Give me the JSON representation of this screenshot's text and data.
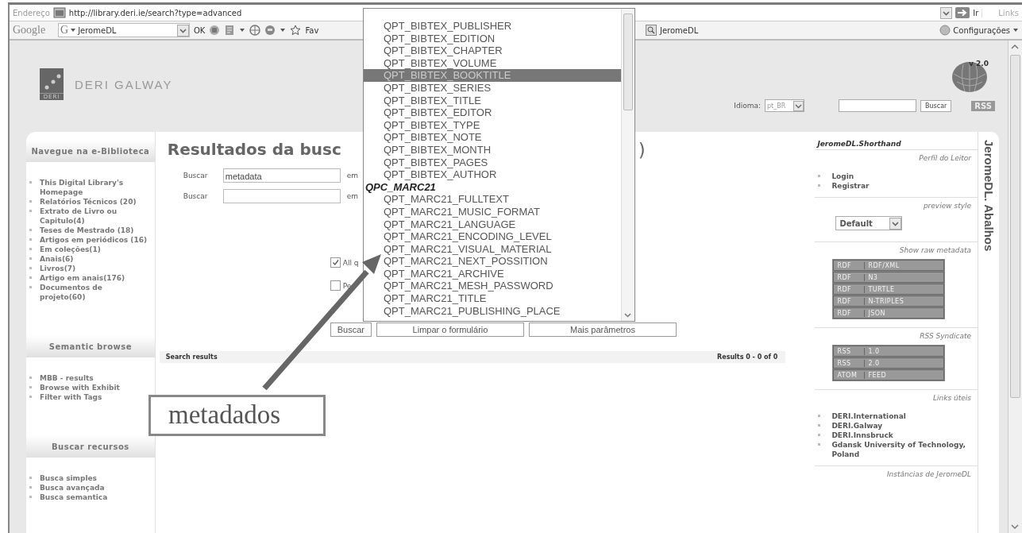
{
  "address_bar": {
    "label": "Endereço",
    "url": "http://library.deri.ie/search?type=advanced",
    "go": "Ir",
    "links": "Links"
  },
  "google_toolbar": {
    "brand": "Google",
    "engine": "G",
    "search_value": "JeromeDL",
    "ok": "OK",
    "favorites": "Fav",
    "bookmark": "JeromeDL",
    "settings": "Configurações"
  },
  "header": {
    "logo_badge": "DERI",
    "logo_text": "DERI GALWAY",
    "version": "v 2.0",
    "language_label": "Idioma:",
    "language_value": "pt_BR",
    "search_button": "Buscar",
    "rss": "RSS"
  },
  "left_sidebar": {
    "sections": [
      {
        "title": "Navegue na e-Biblioteca",
        "items": [
          "This Digital Library's Homepage",
          "Relatórios Técnicos (20)",
          "Extrato de Livro ou Capitulo(4)",
          "Teses de Mestrado (18)",
          "Artigos em periódicos (16)",
          "Em coleções(1)",
          "Anais(6)",
          "Livros(7)",
          "Artigo em anais(176)",
          "Documentos de projeto(60)"
        ]
      },
      {
        "title": "Semantic browse",
        "items": [
          "MBB - results",
          "Browse with Exhibit",
          "Filter with Tags"
        ]
      },
      {
        "title": "Buscar recursos",
        "items": [
          "Busca simples",
          "Busca avançada",
          "Busca semantica"
        ]
      }
    ]
  },
  "main": {
    "heading_start": "Resultados da busc",
    "heading_end": ")",
    "search_rows": [
      {
        "label": "Buscar",
        "value": "metadata",
        "scope_label": "em"
      },
      {
        "label": "Buscar",
        "scope_label": "em"
      }
    ],
    "checkboxes": [
      {
        "label": "All q",
        "checked": true
      },
      {
        "label": "Pe",
        "checked": false
      }
    ],
    "buttons": [
      "Buscar",
      "Limpar o formulário",
      "Mais parâmetros"
    ],
    "results_title": "Search results",
    "results_count": "Results 0 - 0 of 0"
  },
  "dropdown": {
    "items": [
      {
        "kind": "option",
        "label": "QPT_BIBTEX_PUBLISHER",
        "selected": false
      },
      {
        "kind": "option",
        "label": "QPT_BIBTEX_EDITION",
        "selected": false
      },
      {
        "kind": "option",
        "label": "QPT_BIBTEX_CHAPTER",
        "selected": false
      },
      {
        "kind": "option",
        "label": "QPT_BIBTEX_VOLUME",
        "selected": false
      },
      {
        "kind": "option",
        "label": "QPT_BIBTEX_BOOKTITLE",
        "selected": true
      },
      {
        "kind": "option",
        "label": "QPT_BIBTEX_SERIES",
        "selected": false
      },
      {
        "kind": "option",
        "label": "QPT_BIBTEX_TITLE",
        "selected": false
      },
      {
        "kind": "option",
        "label": "QPT_BIBTEX_EDITOR",
        "selected": false
      },
      {
        "kind": "option",
        "label": "QPT_BIBTEX_TYPE",
        "selected": false
      },
      {
        "kind": "option",
        "label": "QPT_BIBTEX_NOTE",
        "selected": false
      },
      {
        "kind": "option",
        "label": "QPT_BIBTEX_MONTH",
        "selected": false
      },
      {
        "kind": "option",
        "label": "QPT_BIBTEX_PAGES",
        "selected": false
      },
      {
        "kind": "option",
        "label": "QPT_BIBTEX_AUTHOR",
        "selected": false
      },
      {
        "kind": "group",
        "label": "QPC_MARC21",
        "selected": false
      },
      {
        "kind": "option",
        "label": "QPT_MARC21_FULLTEXT",
        "selected": false
      },
      {
        "kind": "option",
        "label": "QPT_MARC21_MUSIC_FORMAT",
        "selected": false
      },
      {
        "kind": "option",
        "label": "QPT_MARC21_LANGUAGE",
        "selected": false
      },
      {
        "kind": "option",
        "label": "QPT_MARC21_ENCODING_LEVEL",
        "selected": false
      },
      {
        "kind": "option",
        "label": "QPT_MARC21_VISUAL_MATERIAL",
        "selected": false
      },
      {
        "kind": "option",
        "label": "QPT_MARC21_NEXT_POSSITION",
        "selected": false
      },
      {
        "kind": "option",
        "label": "QPT_MARC21_ARCHIVE",
        "selected": false
      },
      {
        "kind": "option",
        "label": "QPT_MARC21_MESH_PASSWORD",
        "selected": false
      },
      {
        "kind": "option",
        "label": "QPT_MARC21_TITLE",
        "selected": false
      },
      {
        "kind": "option",
        "label": "QPT_MARC21_PUBLISHING_PLACE",
        "selected": false
      }
    ]
  },
  "right_sidebar": {
    "title": "JeromeDL.Shorthand",
    "profile": {
      "title": "Perfil do Leitor",
      "links": [
        "Login",
        "Registrar"
      ]
    },
    "preview": {
      "title": "preview style",
      "value": "Default"
    },
    "raw_metadata": {
      "title": "Show raw metadata",
      "badges": [
        {
          "type": "RDF",
          "format": "RDF/XML"
        },
        {
          "type": "RDF",
          "format": "N3"
        },
        {
          "type": "RDF",
          "format": "TURTLE"
        },
        {
          "type": "RDF",
          "format": "N-TRIPLES"
        },
        {
          "type": "RDF",
          "format": "JSON"
        }
      ]
    },
    "syndicate": {
      "title": "RSS Syndicate",
      "badges": [
        {
          "type": "RSS",
          "format": "1.0"
        },
        {
          "type": "RSS",
          "format": "2.0"
        },
        {
          "type": "ATOM",
          "format": "FEED"
        }
      ]
    },
    "useful_links": {
      "title": "Links úteis",
      "items": [
        "DERI.International",
        "DERI.Galway",
        "DERI.Innsbruck",
        "Gdansk University of Technology, Poland"
      ]
    },
    "instances": {
      "title": "Instâncias de JeromeDL"
    }
  },
  "side_tab": "JeromeDL. Abalhos",
  "annotation": {
    "label": "metadados"
  }
}
